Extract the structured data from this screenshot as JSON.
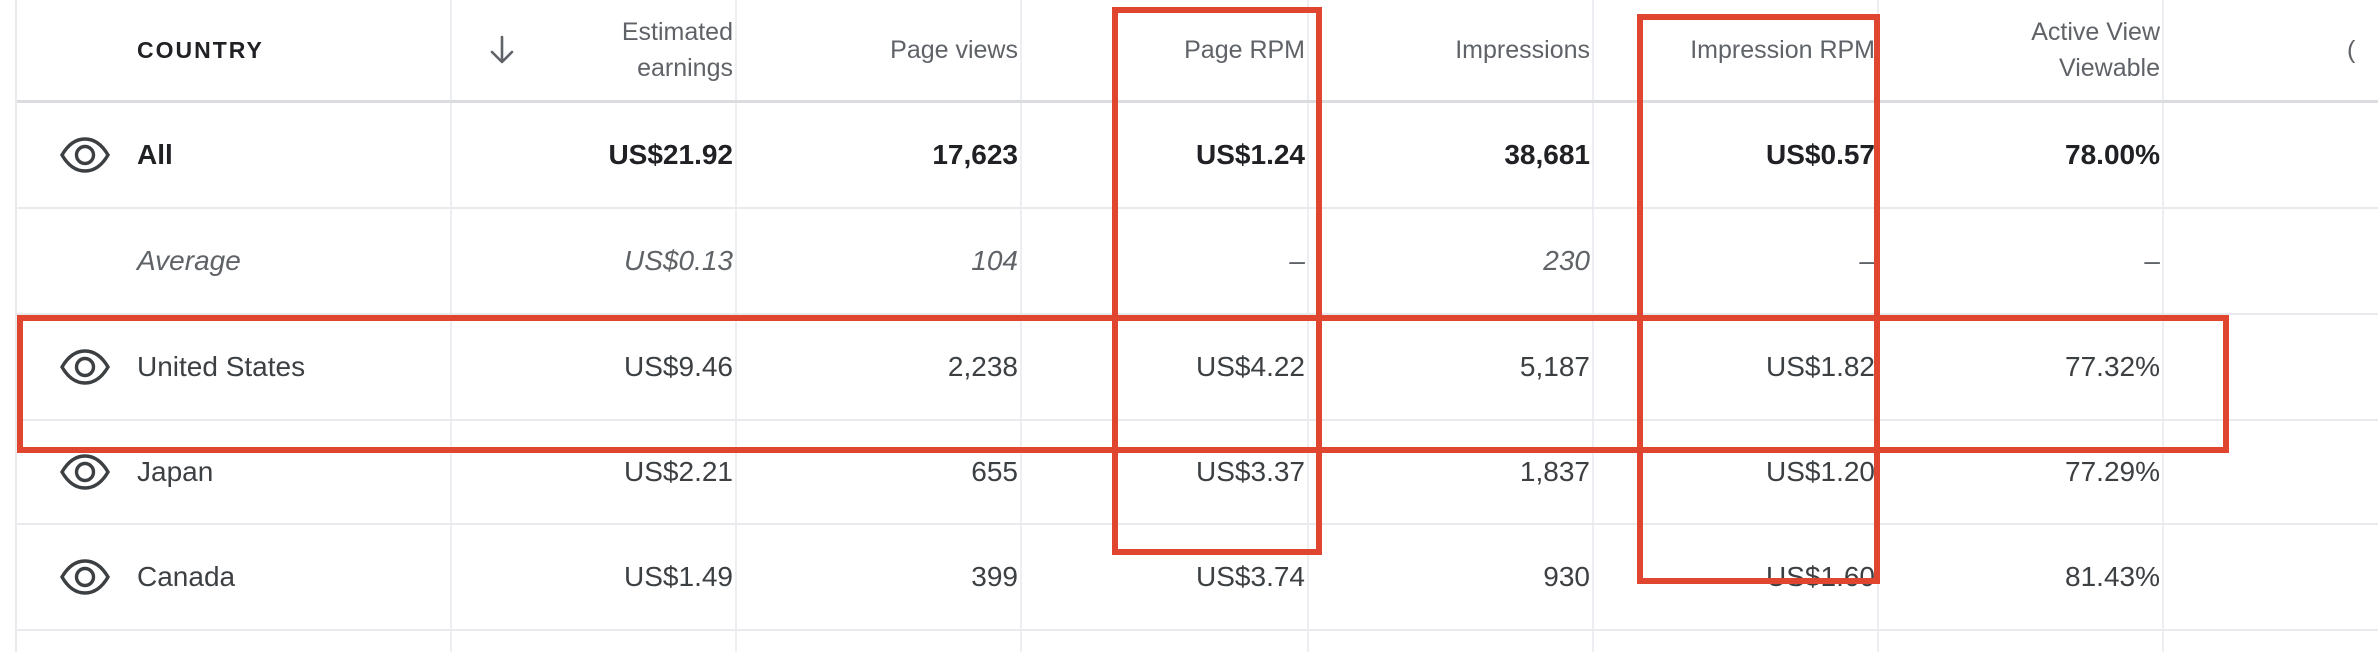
{
  "header": {
    "country": "COUNTRY",
    "sort_icon": "arrow-down-icon",
    "estimated_earnings": [
      "Estimated",
      "earnings"
    ],
    "page_views": "Page views",
    "page_rpm": "Page RPM",
    "impressions": "Impressions",
    "impression_rpm": "Impression RPM",
    "active_view_viewable": [
      "Active View",
      "Viewable"
    ],
    "cut_off": "("
  },
  "rows": [
    {
      "country": "All",
      "earnings": "US$21.92",
      "page_views": "17,623",
      "page_rpm": "US$1.24",
      "impressions": "38,681",
      "impression_rpm": "US$0.57",
      "active_view": "78.00%"
    },
    {
      "country": "Average",
      "earnings": "US$0.13",
      "page_views": "104",
      "page_rpm": "–",
      "impressions": "230",
      "impression_rpm": "–",
      "active_view": "–"
    },
    {
      "country": "United States",
      "earnings": "US$9.46",
      "page_views": "2,238",
      "page_rpm": "US$4.22",
      "impressions": "5,187",
      "impression_rpm": "US$1.82",
      "active_view": "77.32%"
    },
    {
      "country": "Japan",
      "earnings": "US$2.21",
      "page_views": "655",
      "page_rpm": "US$3.37",
      "impressions": "1,837",
      "impression_rpm": "US$1.20",
      "active_view": "77.29%"
    },
    {
      "country": "Canada",
      "earnings": "US$1.49",
      "page_views": "399",
      "page_rpm": "US$3.74",
      "impressions": "930",
      "impression_rpm": "US$1.60",
      "active_view": "81.43%"
    }
  ],
  "icons": {
    "visibility": "eye-icon"
  },
  "colors": {
    "highlight": "#e0452f",
    "grid": "#e8eaed",
    "text": "#3c4043",
    "header_text": "#5f6368"
  }
}
